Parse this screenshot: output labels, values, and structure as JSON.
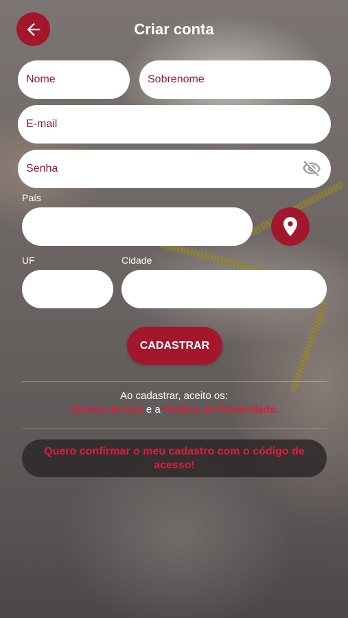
{
  "header": {
    "title": "Criar conta",
    "back_icon": "arrow-left-icon"
  },
  "form": {
    "first_name": {
      "placeholder": "Nome",
      "value": ""
    },
    "last_name": {
      "placeholder": "Sobrenome",
      "value": ""
    },
    "email": {
      "placeholder": "E-mail",
      "value": ""
    },
    "password": {
      "placeholder": "Senha",
      "value": "",
      "toggle_icon": "eye-off-icon"
    },
    "country": {
      "label": "País",
      "value": ""
    },
    "location_icon": "map-pin-icon",
    "state": {
      "label": "UF",
      "value": ""
    },
    "city": {
      "label": "Cidade",
      "value": ""
    },
    "submit_label": "CADASTRAR"
  },
  "terms": {
    "prefix": "Ao cadastrar, aceito os:",
    "terms_link": "Termos de Uso",
    "conjunction": "e a",
    "privacy_link": "Política de Privacidade."
  },
  "confirm": {
    "label": "Quero confirmar o meu cadastro com o código de acesso!"
  },
  "colors": {
    "primary": "#a3162b",
    "link": "#d81f3c",
    "field_bg": "#ffffff"
  }
}
